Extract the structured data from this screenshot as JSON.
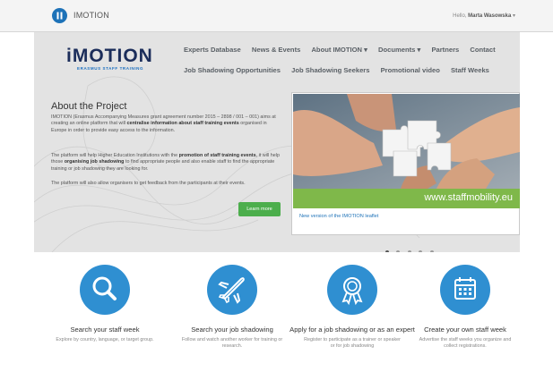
{
  "topbar": {
    "brand": "IMOTION",
    "greeting_prefix": "Hello,",
    "user_name": "Marta Wasowska",
    "user_caret": "▾"
  },
  "logo": {
    "word": "iMOTION",
    "tagline": "ERASMUS STAFF TRAINING"
  },
  "nav": {
    "row1": [
      "Experts Database",
      "News & Events",
      "About IMOTION ▾",
      "Documents ▾",
      "Partners",
      "Contact"
    ],
    "row2": [
      "Job Shadowing Opportunities",
      "Job Shadowing Seekers",
      "Promotional video",
      "Staff Weeks"
    ]
  },
  "about": {
    "title": "About the Project",
    "p1_a": "IMOTION (Erasmus Accompanying Measures grant agreement number 2015 – 2898 / 001 – 001) aims at creating an online platform that will ",
    "p1_b": "centralise information about staff training events",
    "p1_c": " organised in Europe in order to provide easy access to the information.",
    "p2_a": "The platform will help Higher Education Institutions with the ",
    "p2_b": "promotion of staff training events",
    "p2_c": ", it will help those ",
    "p2_d": "organising job shadowing",
    "p2_e": " to find appropriate people and also enable staff to find the appropriate training or job shadowing they are looking for.",
    "p3": "The platform will also allow organisers to get feedback from the participants at their events.",
    "learn_more": "Learn more"
  },
  "slider": {
    "url_text": "www.staffmobility.eu",
    "caption": "New version of the IMOTION leaflet",
    "dot_count": 5,
    "active_index": 0
  },
  "features": [
    {
      "icon": "search-icon",
      "title": "Search your staff week",
      "desc": "Explore by country, language, or target group."
    },
    {
      "icon": "airplane-icon",
      "title": "Search your job shadowing",
      "desc": "Follow and watch another worker for training or research."
    },
    {
      "icon": "award-ribbon-icon",
      "title": "Apply for a job shadowing or as an expert",
      "desc": "Register to participate as a trainer or speaker or for job shadowing"
    },
    {
      "icon": "calendar-icon",
      "title": "Create your own staff week",
      "desc": "Advertise the staff weeks you organize and collect registrations."
    }
  ],
  "colors": {
    "accent": "#2f8fd1",
    "button_green": "#4cae4c",
    "url_bar_green": "#7fb84a",
    "logo_navy": "#1b2d5a"
  }
}
